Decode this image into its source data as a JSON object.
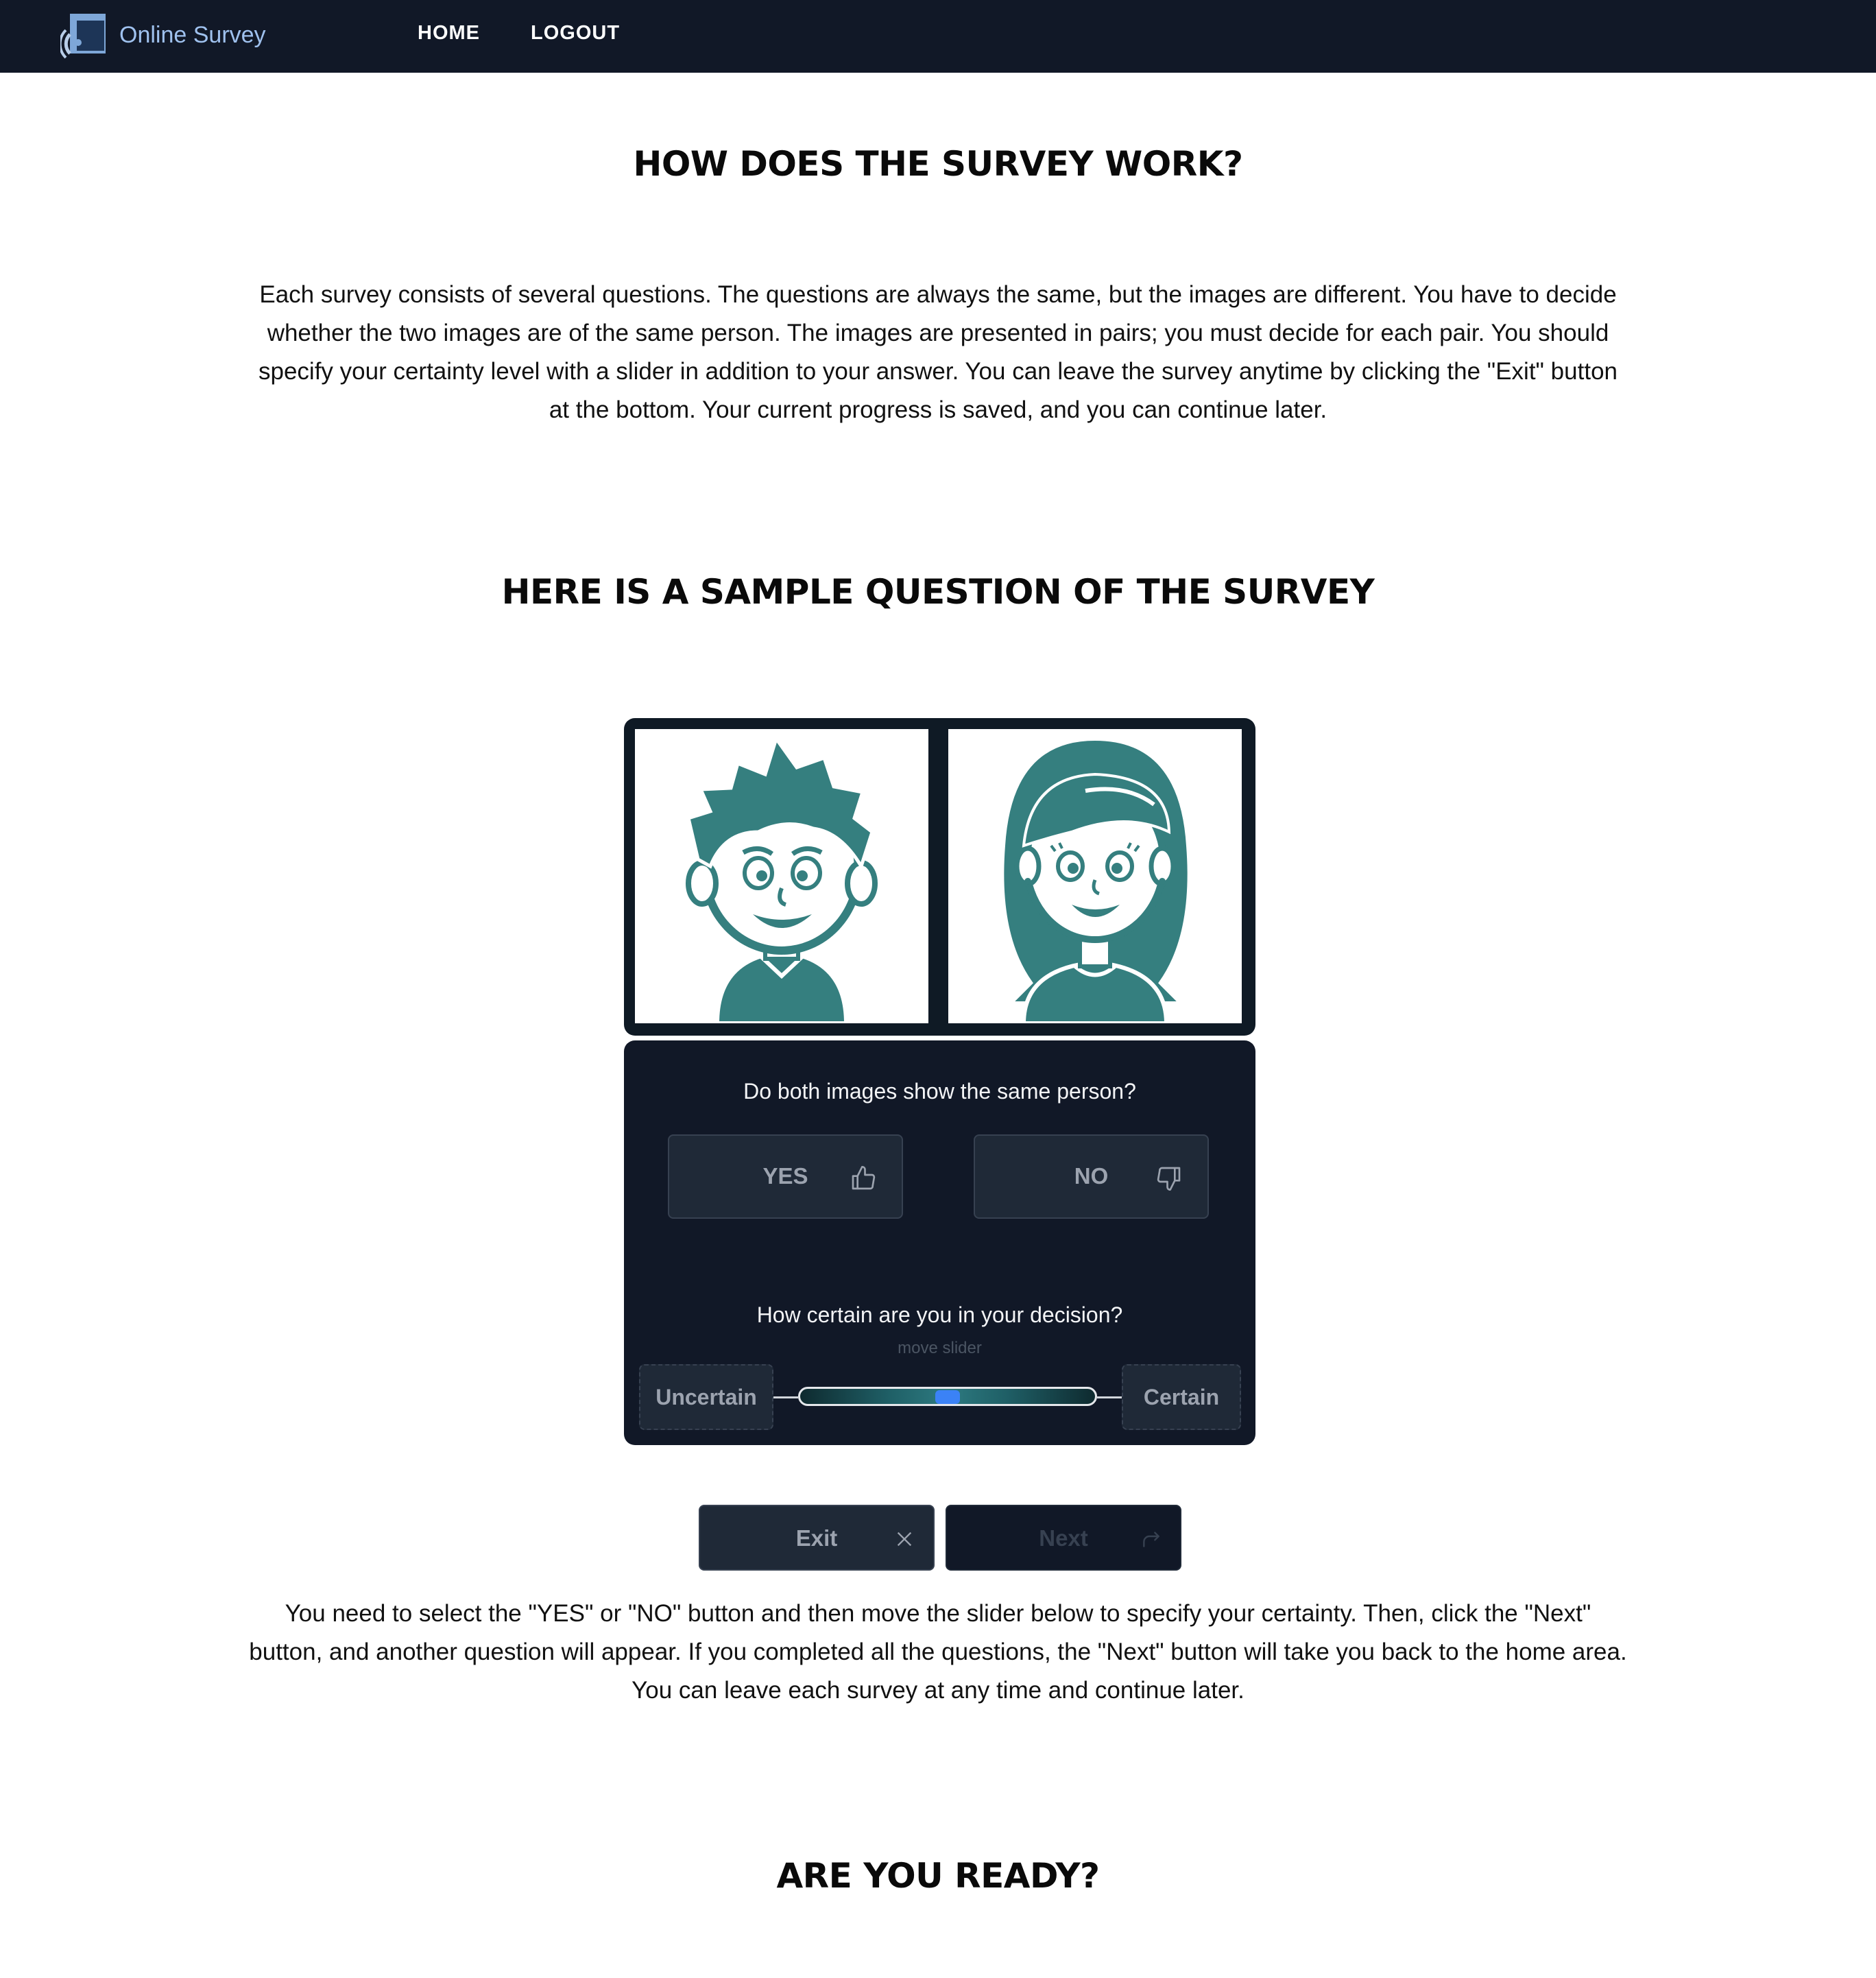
{
  "nav": {
    "brand": "Online Survey",
    "links": [
      "HOME",
      "LOGOUT"
    ]
  },
  "section1": {
    "title": "HOW DOES THE SURVEY WORK?",
    "text": "Each survey consists of several questions. The questions are always the same, but the images are different. You have to decide whether the two images are of the same person. The images are presented in pairs; you must decide for each pair. You should specify your certainty level with a slider in addition to your answer. You can leave the survey anytime by clicking the \"Exit\" button at the bottom. Your current progress is saved, and you can continue later."
  },
  "section2": {
    "title": "HERE IS A SAMPLE QUESTION OF THE SURVEY",
    "sample": {
      "question": "Do both images show the same person?",
      "yes_label": "YES",
      "no_label": "NO",
      "certainty_question": "How certain are you in your decision?",
      "slider_hint": "move slider",
      "uncertain_label": "Uncertain",
      "certain_label": "Certain",
      "slider_value": 0.5,
      "exit_label": "Exit",
      "next_label": "Next",
      "icons": [
        "thumbs-up-icon",
        "thumbs-down-icon",
        "close-icon",
        "redo-arrow-icon"
      ]
    },
    "text": "You need to select the \"YES\" or \"NO\" button and then move the slider below to specify your certainty. Then, click the \"Next\" button, and another question will appear. If you completed all the questions, the \"Next\" button will take you back to the home area. You can leave each survey at any time and continue later."
  },
  "section3": {
    "title": "ARE YOU READY?"
  },
  "colors": {
    "navbar": "#111827",
    "panel": "#111827",
    "avatar_teal": "#357f7f",
    "brand_text": "#9fc1ee",
    "slider_thumb": "#3b82f6"
  }
}
